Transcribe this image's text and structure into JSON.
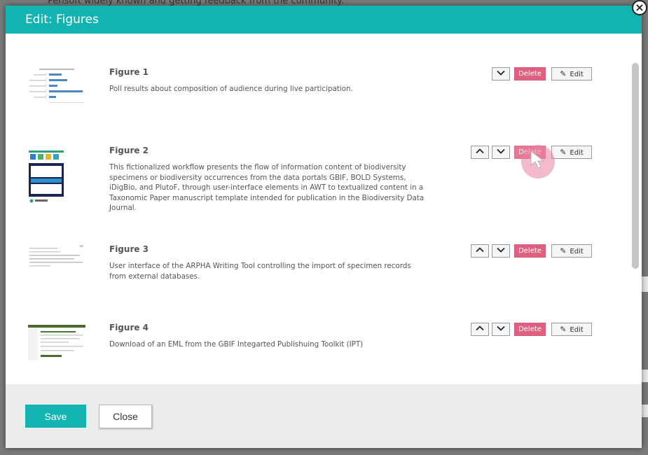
{
  "background": {
    "text": "Pensoft widely known and getting feedback from the community."
  },
  "modal": {
    "title": "Edit: Figures",
    "close_icon": "×"
  },
  "buttons": {
    "delete_label": "Delete",
    "edit_label": "Edit",
    "up_icon": "chevron-up",
    "down_icon": "chevron-down"
  },
  "figures": [
    {
      "title": "Figure 1",
      "caption": "Poll results about composition of audience during live participation.",
      "has_up": false
    },
    {
      "title": "Figure 2",
      "caption": "This fictionalized workflow presents the flow of information content of biodiversity specimens or biodiversity occurrences from the data portals GBIF, BOLD Systems, iDigBio, and PlutoF, through user-interface elements in AWT to textualized content in a Taxonomic Paper manuscript template intended for publication in the Biodiversity Data Journal.",
      "has_up": true
    },
    {
      "title": "Figure 3",
      "caption": "User interface of the ARPHA Writing Tool controlling the import of specimen records from external databases.",
      "has_up": true
    },
    {
      "title": "Figure 4",
      "caption": "Download of an EML from the GBIF Integarted Publishuing Toolkit (IPT)",
      "has_up": true
    }
  ],
  "footer": {
    "save_label": "Save",
    "close_label": "Close"
  },
  "colors": {
    "accent": "#12b3b0",
    "delete": "#e0607f",
    "footer_bg": "#ececec"
  }
}
